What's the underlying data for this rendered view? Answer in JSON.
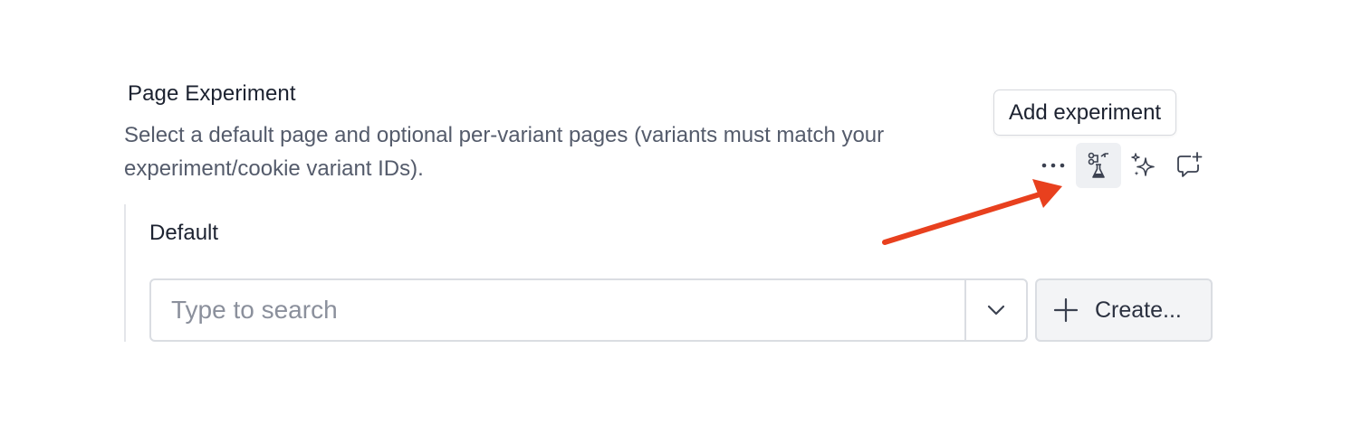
{
  "field": {
    "title": "Page Experiment",
    "description": "Select a default page and optional per-variant pages (variants must match your experiment/cookie variant IDs)."
  },
  "tooltip": {
    "text": "Add experiment"
  },
  "actions": [
    {
      "name": "more-icon"
    },
    {
      "name": "experiment-flask-icon",
      "active": true
    },
    {
      "name": "sparkles-icon"
    },
    {
      "name": "add-comment-icon"
    }
  ],
  "default_group": {
    "label": "Default",
    "search": {
      "placeholder": "Type to search",
      "value": ""
    },
    "create_label": "Create..."
  },
  "colors": {
    "annotation_arrow": "#e8401e",
    "active_bg": "#eef0f3",
    "border": "#dadde2"
  }
}
